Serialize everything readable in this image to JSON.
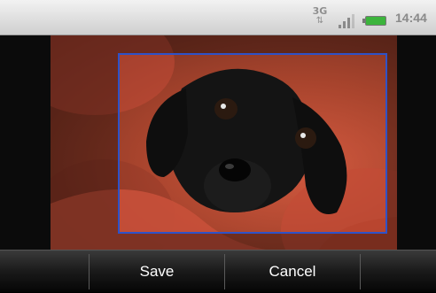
{
  "status_bar": {
    "network_type": "3G",
    "network_arrows": "⇅",
    "clock": "14:44",
    "icons": [
      "network-3g-icon",
      "signal-icon",
      "battery-icon"
    ],
    "signal_level": 0.75,
    "battery_level": 1.0,
    "battery_color": "#3cb43c"
  },
  "photo": {
    "subject": "image",
    "crop_color": "#2e52c8"
  },
  "actions": {
    "save_label": "Save",
    "cancel_label": "Cancel"
  }
}
